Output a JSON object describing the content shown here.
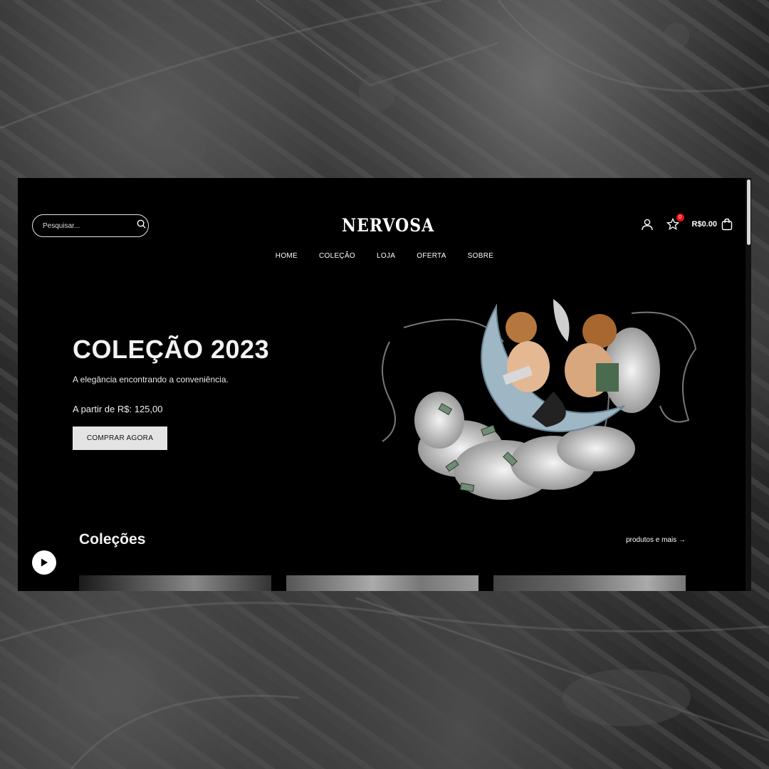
{
  "header": {
    "search_placeholder": "Pesquisar...",
    "logo": "NERVOSA",
    "favorites_count": "0",
    "cart_total": "R$0.00"
  },
  "nav": {
    "items": [
      "HOME",
      "COLEÇÃO",
      "LOJA",
      "OFERTA",
      "SOBRE"
    ]
  },
  "hero": {
    "title": "COLEÇÃO 2023",
    "subtitle": "A elegância encontrando a conveniência.",
    "price": "A partir de R$: 125,00",
    "cta": "COMPRAR AGORA"
  },
  "collections": {
    "title": "Coleções",
    "link": "produtos e mais →"
  },
  "icons": {
    "search": "search-icon",
    "user": "user-icon",
    "favorites": "star-icon",
    "cart": "shopping-bag-icon",
    "media": "play-icon"
  },
  "colors": {
    "page_background": "#000000",
    "text": "#ffffff",
    "button": "#e4e4e4",
    "badge": "#ee1111"
  }
}
